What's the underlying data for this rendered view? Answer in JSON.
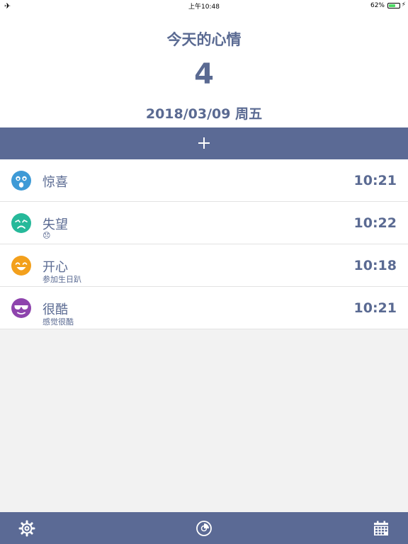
{
  "status_bar": {
    "time": "上午10:48",
    "battery_percent": "62%",
    "battery_level": 0.62
  },
  "header": {
    "title": "今天的心情",
    "count": "4",
    "date": "2018/03/09 周五"
  },
  "entries": [
    {
      "mood": "惊喜",
      "note": "",
      "time": "10:21",
      "icon": "surprised-face-icon",
      "color": "#3e9ad6"
    },
    {
      "mood": "失望",
      "note": "😞",
      "time": "10:22",
      "icon": "disappointed-face-icon",
      "color": "#26b99a"
    },
    {
      "mood": "开心",
      "note": "参加生日趴",
      "time": "10:18",
      "icon": "happy-face-icon",
      "color": "#f3a01c"
    },
    {
      "mood": "很酷",
      "note": "感觉很酷",
      "time": "10:21",
      "icon": "cool-face-icon",
      "color": "#8e44ad"
    }
  ],
  "tabbar": {
    "items": [
      "settings-gear-icon",
      "stats-chart-icon",
      "calendar-icon"
    ]
  },
  "colors": {
    "accent": "#5b6a95",
    "text": "#5a6a92"
  }
}
